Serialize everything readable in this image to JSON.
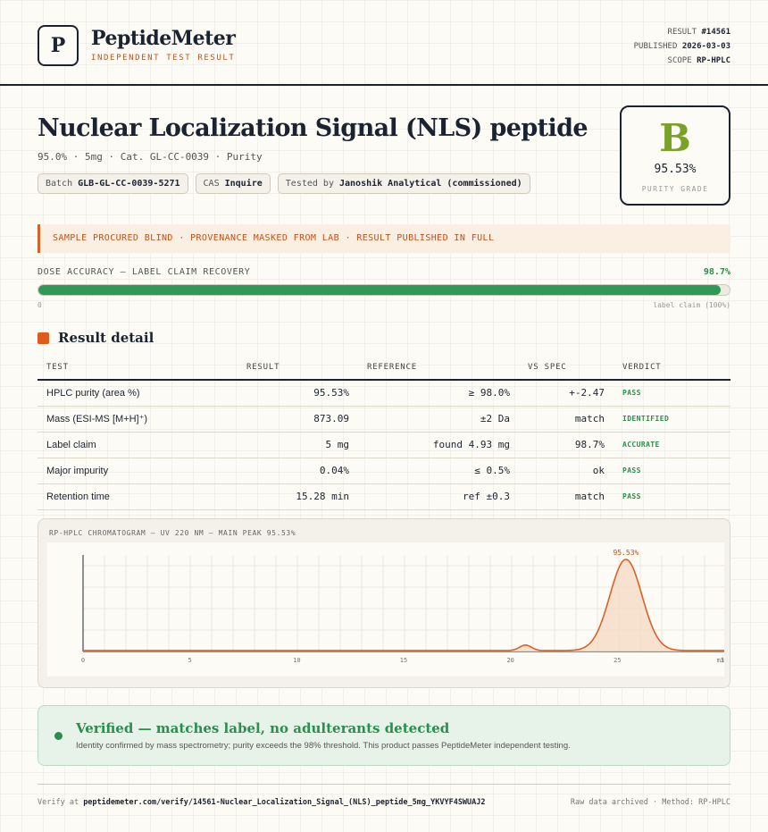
{
  "brand": {
    "logo_letter": "P",
    "name": "PeptideMeter",
    "tagline": "INDEPENDENT TEST RESULT"
  },
  "meta": {
    "result_label": "RESULT",
    "result_value": "#14561",
    "published_label": "PUBLISHED",
    "published_value": "2026-03-03",
    "scope_label": "SCOPE",
    "scope_value": "RP-HPLC"
  },
  "product": {
    "title": "Nuclear Localization Signal (NLS) peptide",
    "subtitle": "95.0% · 5mg · Cat. GL-CC-0039 · Purity"
  },
  "chips": {
    "batch_label": "Batch",
    "batch_value": "GLB-GL-CC-0039-5271",
    "cas_label": "CAS",
    "cas_value": "Inquire",
    "tested_label": "Tested by",
    "tested_value": "Janoshik Analytical (commissioned)"
  },
  "grade": {
    "letter": "B",
    "value": "95.53%",
    "label": "PURITY GRADE",
    "color": "#7aa226"
  },
  "notice": "SAMPLE PROCURED BLIND · PROVENANCE MASKED FROM LAB · RESULT PUBLISHED IN FULL",
  "dose": {
    "label": "DOSE ACCURACY — LABEL CLAIM RECOVERY",
    "value": "98.7%",
    "fraction": 0.987,
    "min_label": "0",
    "max_label": "label claim (100%)"
  },
  "section": {
    "title": "Result detail"
  },
  "table": {
    "headers": [
      "TEST",
      "RESULT",
      "REFERENCE",
      "VS SPEC",
      "VERDICT"
    ],
    "rows": [
      {
        "test": "HPLC purity (area %)",
        "result": "95.53%",
        "reference": "≥ 98.0%",
        "vs": "+-2.47",
        "verdict": "PASS"
      },
      {
        "test": "Mass (ESI-MS [M+H]⁺)",
        "result": "873.09",
        "reference": "±2 Da",
        "vs": "match",
        "verdict": "IDENTIFIED"
      },
      {
        "test": "Label claim",
        "result": "5 mg",
        "reference": "found 4.93 mg",
        "vs": "98.7%",
        "verdict": "ACCURATE"
      },
      {
        "test": "Major impurity",
        "result": "0.04%",
        "reference": "≤ 0.5%",
        "vs": "ok",
        "verdict": "PASS"
      },
      {
        "test": "Retention time",
        "result": "15.28 min",
        "reference": "ref ±0.3",
        "vs": "match",
        "verdict": "PASS"
      }
    ]
  },
  "chart_data": {
    "type": "line",
    "title": "RP-HPLC CHROMATOGRAM — UV 220 NM — MAIN PEAK 95.53%",
    "xlabel": "",
    "ylabel": "",
    "xlim": [
      0,
      30
    ],
    "x_ticks": [
      0,
      5,
      10,
      15,
      20,
      25,
      30
    ],
    "x_tick_labels": [
      "0",
      "5",
      "10",
      "15",
      "20",
      "25",
      "30"
    ],
    "x_unit_label": "min",
    "baseline": 0.01,
    "peaks": [
      {
        "center": 20.7,
        "height": 0.06,
        "width": 0.28
      },
      {
        "center": 25.4,
        "height": 1.0,
        "width": 0.75
      }
    ],
    "peak_label": "95.53%",
    "peak_label_x": 25.4,
    "line_color": "#d9622b",
    "fill_color": "#f6dcc8",
    "grid": true
  },
  "verified": {
    "title": "Verified — matches label, no adulterants detected",
    "description": "Identity confirmed by mass spectrometry; purity exceeds the 98% threshold. This product passes PeptideMeter independent testing."
  },
  "footer": {
    "verify_prefix": "Verify at",
    "verify_url": "peptidemeter.com/verify/14561-Nuclear_Localization_Signal_(NLS)_peptide_5mg_YKVYF4SWUAJ2",
    "right": "Raw data archived · Method: RP-HPLC"
  }
}
